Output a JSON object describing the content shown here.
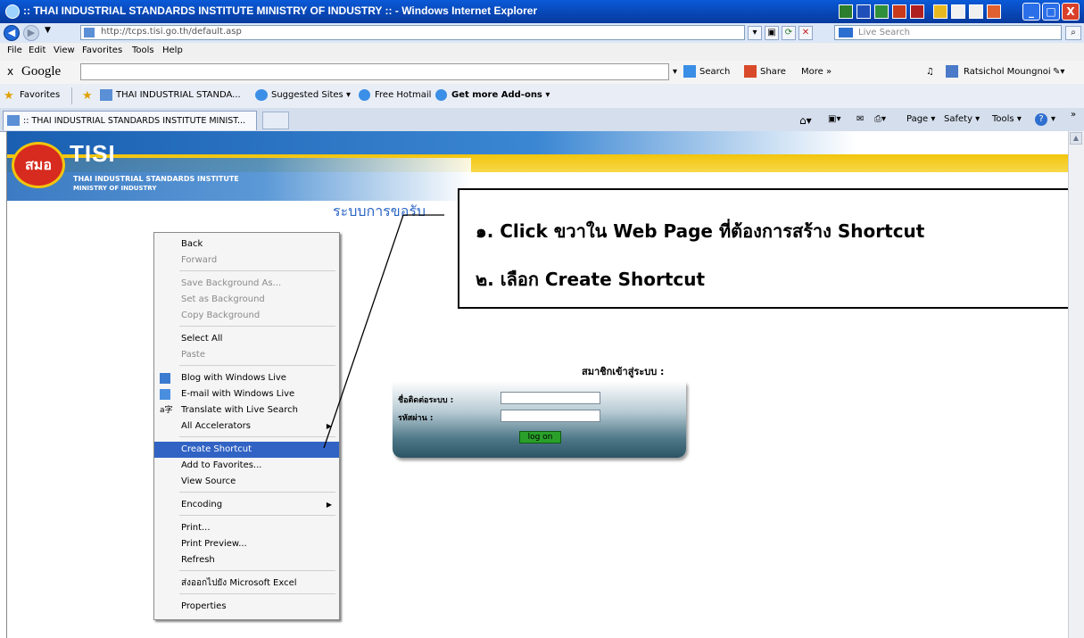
{
  "window": {
    "title": ":: THAI INDUSTRIAL STANDARDS INSTITUTE MINISTRY OF INDUSTRY :: - Windows Internet Explorer",
    "min": "_",
    "max": "□",
    "close": "X"
  },
  "address_bar": {
    "url": "http://tcps.tisi.go.th/default.asp",
    "search_placeholder": "Live Search"
  },
  "menu": [
    "File",
    "Edit",
    "View",
    "Favorites",
    "Tools",
    "Help"
  ],
  "google_toolbar": {
    "close": "x",
    "logo": "Google",
    "search": "Search",
    "share": "Share",
    "more": "More »",
    "user": "Ratsichol Moungnoi"
  },
  "favorites_bar": {
    "favorites": "Favorites",
    "items": [
      "THAI INDUSTRIAL STANDA...",
      "Suggested Sites",
      "Free Hotmail",
      "Get more Add-ons"
    ]
  },
  "tabs": {
    "active": ":: THAI INDUSTRIAL STANDARDS INSTITUTE MINIST...",
    "tools": [
      "Page",
      "Safety",
      "Tools"
    ]
  },
  "site": {
    "logo_text": "สมอ",
    "brand": "TISI",
    "sub1": "THAI INDUSTRIAL STANDARDS INSTITUTE",
    "sub2": "MINISTRY OF INDUSTRY",
    "page_title": "ระบบการขอรับ"
  },
  "callout": {
    "line1": "๑. Click ขวาใน Web Page ที่ต้องการสร้าง Shortcut",
    "line2": "๒. เลือก Create Shortcut"
  },
  "login": {
    "heading": "สมาชิกเข้าสู่ระบบ :",
    "username_label": "ชื่อติดต่อระบบ :",
    "password_label": "รหัสผ่าน :",
    "button": "log on"
  },
  "context_menu": {
    "items": [
      {
        "label": "Back",
        "disabled": false
      },
      {
        "label": "Forward",
        "disabled": true
      },
      {
        "label": "Save Background As...",
        "disabled": true
      },
      {
        "label": "Set as Background",
        "disabled": true
      },
      {
        "label": "Copy Background",
        "disabled": true
      },
      {
        "label": "Select All",
        "disabled": false
      },
      {
        "label": "Paste",
        "disabled": true
      },
      {
        "label": "Blog with Windows Live",
        "disabled": false
      },
      {
        "label": "E-mail with Windows Live",
        "disabled": false
      },
      {
        "label": "Translate with Live Search",
        "disabled": false
      },
      {
        "label": "All Accelerators",
        "disabled": false
      },
      {
        "label": "Create Shortcut",
        "disabled": false,
        "selected": true
      },
      {
        "label": "Add to Favorites...",
        "disabled": false
      },
      {
        "label": "View Source",
        "disabled": false
      },
      {
        "label": "Encoding",
        "disabled": false
      },
      {
        "label": "Print...",
        "disabled": false
      },
      {
        "label": "Print Preview...",
        "disabled": false
      },
      {
        "label": "Refresh",
        "disabled": false
      },
      {
        "label": "ส่งออกไปยัง Microsoft Excel",
        "disabled": false
      },
      {
        "label": "Properties",
        "disabled": false
      }
    ]
  },
  "colors": {
    "titlebar": "#0846b4",
    "menu_selection": "#3163c4",
    "page_title": "#2c67c4",
    "tisi_yellow": "#f2c40c"
  }
}
